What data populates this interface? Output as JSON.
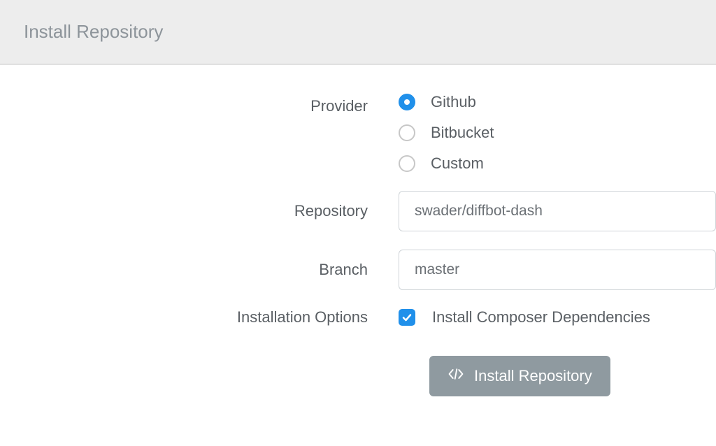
{
  "header": {
    "title": "Install Repository"
  },
  "form": {
    "provider": {
      "label": "Provider",
      "options": [
        {
          "label": "Github",
          "selected": true
        },
        {
          "label": "Bitbucket",
          "selected": false
        },
        {
          "label": "Custom",
          "selected": false
        }
      ]
    },
    "repository": {
      "label": "Repository",
      "value": "swader/diffbot-dash"
    },
    "branch": {
      "label": "Branch",
      "value": "master"
    },
    "installation_options": {
      "label": "Installation Options",
      "composer": {
        "label": "Install Composer Dependencies",
        "checked": true
      }
    },
    "submit_label": "Install Repository"
  }
}
